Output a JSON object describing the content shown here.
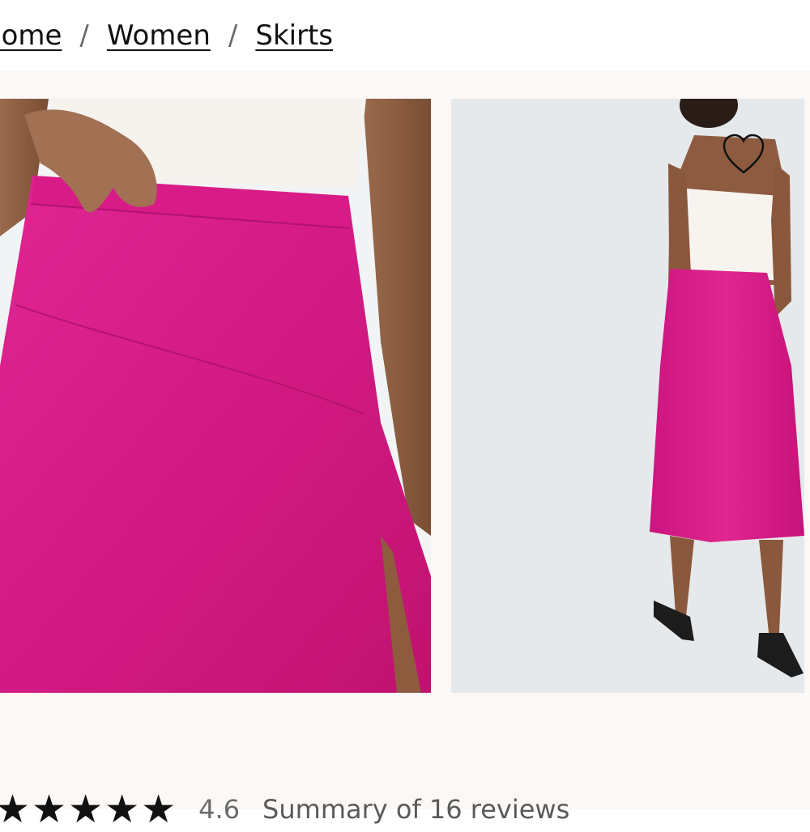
{
  "breadcrumb": {
    "items": [
      "Home",
      "Women",
      "Skirts"
    ],
    "separator": "/"
  },
  "gallery": {
    "images": [
      {
        "alt": "Pink satin midi skirt, front detail",
        "color": "#d81b86"
      },
      {
        "alt": "Pink satin midi skirt, back view on model",
        "color": "#d81b86"
      }
    ]
  },
  "wishlist": {
    "icon": "heart-outline-icon"
  },
  "reviews": {
    "stars": [
      "★",
      "★",
      "★",
      "★",
      "★"
    ],
    "rating": "4.6",
    "summary": "Summary of 16 reviews"
  },
  "colors": {
    "accent": "#d81b86",
    "background": "#fbf8f5",
    "text": "#111111"
  }
}
